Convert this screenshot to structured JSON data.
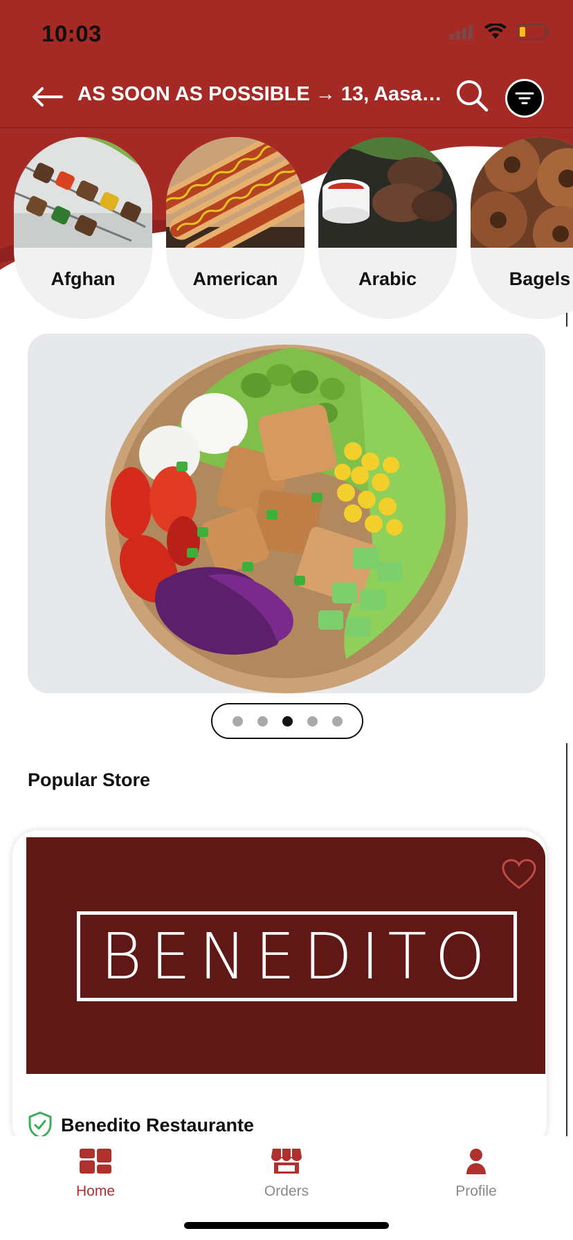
{
  "status_bar": {
    "time": "10:03"
  },
  "header": {
    "title": "AS SOON AS POSSIBLE → 13, Aasath...",
    "back_icon": "arrow-left-icon",
    "search_icon": "search-icon",
    "filter_icon": "filter-icon"
  },
  "categories": [
    {
      "label": "Afghan",
      "image": "kebab-skewers"
    },
    {
      "label": "American",
      "image": "hot-dogs"
    },
    {
      "label": "Arabic",
      "image": "kofta-with-sauces"
    },
    {
      "label": "Bagels",
      "image": "bagels"
    }
  ],
  "banner": {
    "image": "salad-bowl",
    "slide_count": 5,
    "active_slide": 3
  },
  "popular": {
    "title": "Popular Store",
    "stores": [
      {
        "name": "Benedito Restaurante",
        "logo_text": "BENEDITO",
        "verified": true,
        "favorite": false
      }
    ]
  },
  "nav": {
    "home": "Home",
    "orders": "Orders",
    "profile": "Profile",
    "active": "home"
  },
  "colors": {
    "brand": "#a52a26",
    "brand_dark": "#601816",
    "inactive": "#8a8a8a",
    "chip_bg": "#f1f1f1"
  }
}
